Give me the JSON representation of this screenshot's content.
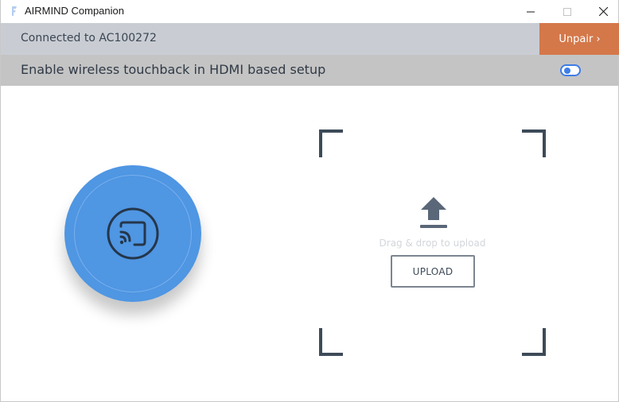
{
  "window": {
    "title": "AIRMIND Companion",
    "logo_icon": "app-logo-icon",
    "controls": [
      "minimize-icon",
      "maximize-icon",
      "close-icon"
    ]
  },
  "connection": {
    "status_text": "Connected to AC100272",
    "unpair_label": "Unpair ›",
    "unpair_color": "#d4784a",
    "bar_color": "#c9cdd3"
  },
  "touchback": {
    "label": "Enable wireless touchback in HDMI based setup",
    "toggle_on": false,
    "toggle_color": "#3e7de8"
  },
  "cast": {
    "icon": "cast-icon",
    "color": "#4f96e3"
  },
  "upload": {
    "icon": "upload-icon",
    "drag_text": "Drag & drop to upload",
    "button_label": "UPLOAD"
  }
}
